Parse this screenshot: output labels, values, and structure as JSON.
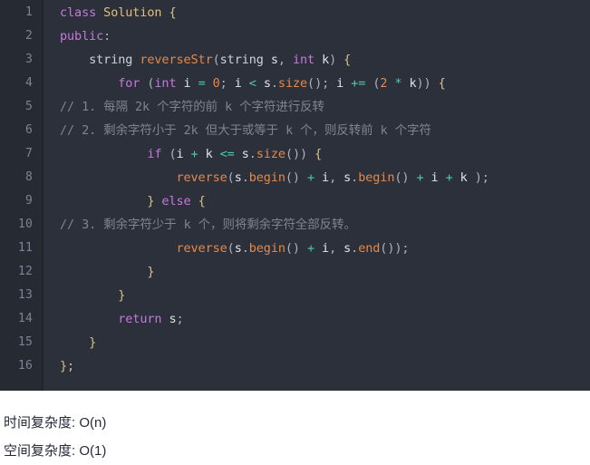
{
  "editor": {
    "theme": "one-dark",
    "language": "cpp",
    "colors": {
      "background": "#2b303b",
      "gutter_background": "#262b33",
      "gutter_text": "#7b8495",
      "keyword": "#c678dd",
      "function": "#e5894b",
      "class_name": "#e5c07b",
      "number": "#e5894b",
      "operator": "#4ec9b0",
      "comment": "#7f848e",
      "text": "#c8ccd4",
      "brace": "#d8c08a"
    },
    "line_numbers": [
      "1",
      "2",
      "3",
      "4",
      "5",
      "6",
      "7",
      "8",
      "9",
      "10",
      "11",
      "12",
      "13",
      "14",
      "15",
      "16"
    ],
    "lines": [
      "class Solution {",
      "public:",
      "    string reverseStr(string s, int k) {",
      "        for (int i = 0; i < s.size(); i += (2 * k)) {",
      "            // 1. 每隔 2k 个字符的前 k 个字符进行反转",
      "            // 2. 剩余字符小于 2k 但大于或等于 k 个，则反转前 k 个字符",
      "            if (i + k <= s.size()) {",
      "                reverse(s.begin() + i, s.begin() + i + k );",
      "            } else {",
      "                // 3. 剩余字符少于 k 个，则将剩余字符全部反转。",
      "                reverse(s.begin() + i, s.end());",
      "            }",
      "        }",
      "        return s;",
      "    }",
      "};",
      ""
    ],
    "tokens": {
      "l1": {
        "kw": "class",
        "cls": "Solution",
        "brace": "{"
      },
      "l2": {
        "kw": "public",
        "pun": ":"
      },
      "l3": {
        "type": "string",
        "fn": "reverseStr",
        "arg_type_1": "string",
        "arg_1": "s",
        "kw": "int",
        "arg_2": "k"
      },
      "l4": {
        "kw": "for",
        "kw2": "int",
        "var": "i",
        "num_zero": "0",
        "fn": "size",
        "num_two": "2",
        "var_k": "k"
      },
      "l5": {
        "comment": "// 1. 每隔 2k 个字符的前 k 个字符进行反转"
      },
      "l6": {
        "comment": "// 2. 剩余字符小于 2k 但大于或等于 k 个，则反转前 k 个字符"
      },
      "l7": {
        "kw": "if",
        "fn": "size"
      },
      "l8": {
        "fn": "reverse",
        "fn2": "begin",
        "fn3": "begin"
      },
      "l9": {
        "kw": "else"
      },
      "l10": {
        "comment": "// 3. 剩余字符少于 k 个，则将剩余字符全部反转。"
      },
      "l11": {
        "fn": "reverse",
        "fn2": "begin",
        "fn3": "end"
      },
      "l14": {
        "kw": "return",
        "var": "s"
      }
    }
  },
  "notes": {
    "time_complexity": "时间复杂度: O(n)",
    "space_complexity": "空间复杂度: O(1)"
  }
}
